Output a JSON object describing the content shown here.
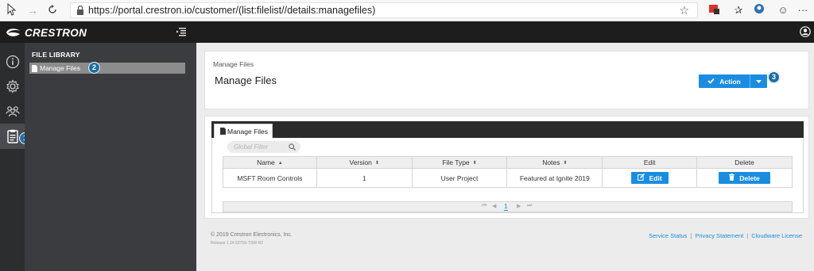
{
  "browser": {
    "url": "https://portal.crestron.io/customer/(list:filelist//details:managefiles)"
  },
  "header": {
    "logo_text": "CRESTRON"
  },
  "sidebar": {
    "title": "FILE LIBRARY",
    "items": [
      {
        "label": "Manage Files"
      }
    ]
  },
  "callouts": [
    "1",
    "2",
    "3"
  ],
  "page": {
    "breadcrumb": "Manage Files",
    "title": "Manage Files",
    "action_label": "Action"
  },
  "tab": {
    "label": "Manage Files"
  },
  "filter": {
    "placeholder": "Global Filter"
  },
  "table": {
    "columns": [
      "Name",
      "Version",
      "File Type",
      "Notes",
      "Edit",
      "Delete"
    ],
    "rows": [
      {
        "name": "MSFT Room Controls",
        "version": "1",
        "file_type": "User Project",
        "notes": "Featured at Ignite 2019",
        "edit_label": "Edit",
        "delete_label": "Delete"
      }
    ]
  },
  "pager": {
    "current_page": "1"
  },
  "footer": {
    "copyright": "© 2019 Crestron Electronics, Inc.",
    "release": "Release 1.14.5375S-TSW-R2",
    "links": [
      "Service Status",
      "Privacy Statement",
      "Cloudware License"
    ]
  },
  "colors": {
    "accent": "#1a8de0",
    "header": "#1d1d1d",
    "sidebar": "#3a3c3f",
    "rail": "#2c2d2f",
    "callout": "#1d6fa5"
  }
}
